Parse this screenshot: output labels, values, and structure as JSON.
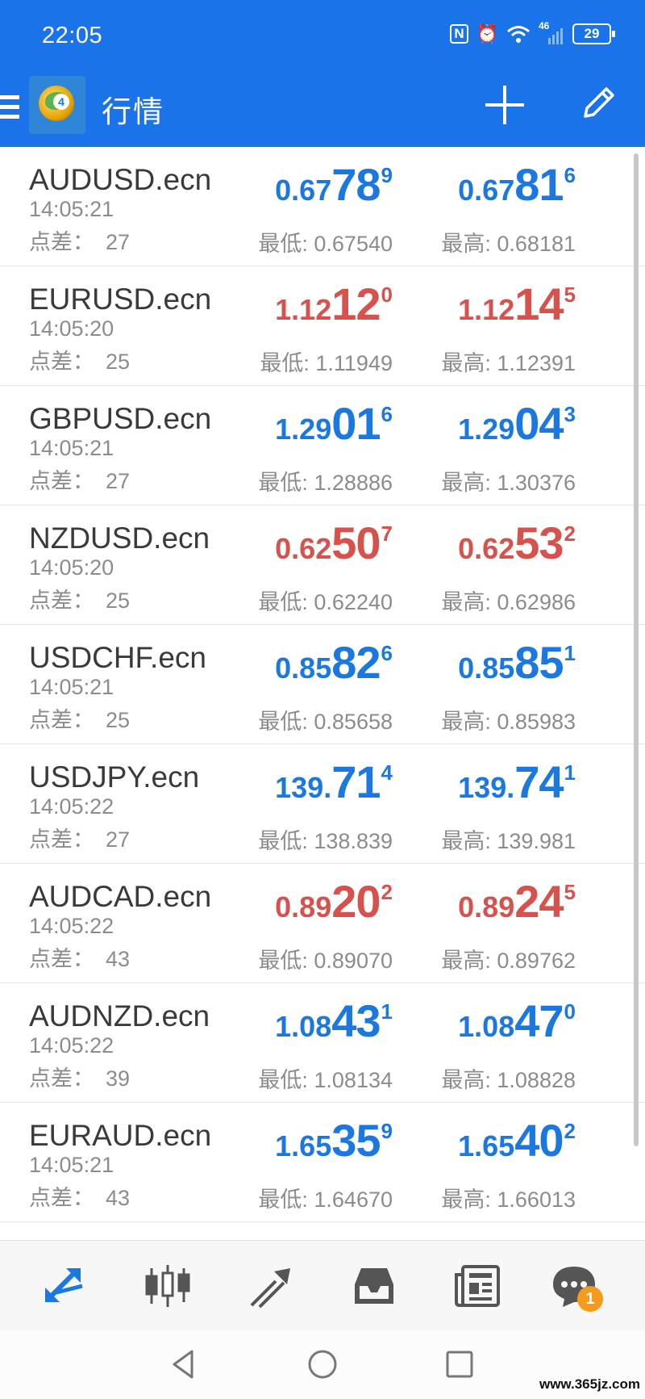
{
  "status_bar": {
    "time": "22:05",
    "nfc_icon": "N",
    "alarm_icon": "⏰",
    "wifi_icon": "wifi",
    "signal_label": "46",
    "battery": "29"
  },
  "app_bar": {
    "title": "行情",
    "menu_icon": "hamburger-icon",
    "logo_icon": "metatrader-logo",
    "add_icon": "plus-icon",
    "edit_icon": "pencil-icon"
  },
  "labels": {
    "spread": "点差：",
    "low": "最低: ",
    "high": "最高: "
  },
  "quotes": [
    {
      "symbol": "AUDUSD.ecn",
      "time": "14:05:21",
      "spread": "27",
      "bid": {
        "small": "0.67",
        "big": "78",
        "sup": "9"
      },
      "ask": {
        "small": "0.67",
        "big": "81",
        "sup": "6"
      },
      "low": "0.67540",
      "high": "0.68181",
      "color": "blue"
    },
    {
      "symbol": "EURUSD.ecn",
      "time": "14:05:20",
      "spread": "25",
      "bid": {
        "small": "1.12",
        "big": "12",
        "sup": "0"
      },
      "ask": {
        "small": "1.12",
        "big": "14",
        "sup": "5"
      },
      "low": "1.11949",
      "high": "1.12391",
      "color": "red"
    },
    {
      "symbol": "GBPUSD.ecn",
      "time": "14:05:21",
      "spread": "27",
      "bid": {
        "small": "1.29",
        "big": "01",
        "sup": "6"
      },
      "ask": {
        "small": "1.29",
        "big": "04",
        "sup": "3"
      },
      "low": "1.28886",
      "high": "1.30376",
      "color": "blue"
    },
    {
      "symbol": "NZDUSD.ecn",
      "time": "14:05:20",
      "spread": "25",
      "bid": {
        "small": "0.62",
        "big": "50",
        "sup": "7"
      },
      "ask": {
        "small": "0.62",
        "big": "53",
        "sup": "2"
      },
      "low": "0.62240",
      "high": "0.62986",
      "color": "red"
    },
    {
      "symbol": "USDCHF.ecn",
      "time": "14:05:21",
      "spread": "25",
      "bid": {
        "small": "0.85",
        "big": "82",
        "sup": "6"
      },
      "ask": {
        "small": "0.85",
        "big": "85",
        "sup": "1"
      },
      "low": "0.85658",
      "high": "0.85983",
      "color": "blue"
    },
    {
      "symbol": "USDJPY.ecn",
      "time": "14:05:22",
      "spread": "27",
      "bid": {
        "small": "139.",
        "big": "71",
        "sup": "4"
      },
      "ask": {
        "small": "139.",
        "big": "74",
        "sup": "1"
      },
      "low": "138.839",
      "high": "139.981",
      "color": "blue"
    },
    {
      "symbol": "AUDCAD.ecn",
      "time": "14:05:22",
      "spread": "43",
      "bid": {
        "small": "0.89",
        "big": "20",
        "sup": "2"
      },
      "ask": {
        "small": "0.89",
        "big": "24",
        "sup": "5"
      },
      "low": "0.89070",
      "high": "0.89762",
      "color": "red"
    },
    {
      "symbol": "AUDNZD.ecn",
      "time": "14:05:22",
      "spread": "39",
      "bid": {
        "small": "1.08",
        "big": "43",
        "sup": "1"
      },
      "ask": {
        "small": "1.08",
        "big": "47",
        "sup": "0"
      },
      "low": "1.08134",
      "high": "1.08828",
      "color": "blue"
    },
    {
      "symbol": "EURAUD.ecn",
      "time": "14:05:21",
      "spread": "43",
      "bid": {
        "small": "1.65",
        "big": "35",
        "sup": "9"
      },
      "ask": {
        "small": "1.65",
        "big": "40",
        "sup": "2"
      },
      "low": "1.64670",
      "high": "1.66013",
      "color": "blue"
    }
  ],
  "colors": {
    "blue": "#1b78e0",
    "red": "#d8524d",
    "appbar": "#1a73e8",
    "badge": "#f59a1b"
  },
  "bottom_nav": {
    "items": [
      "quotes-icon",
      "chart-icon",
      "trade-icon",
      "history-icon",
      "news-icon",
      "messages-icon"
    ],
    "messages_badge": "1"
  },
  "system_nav": {
    "items": [
      "back-icon",
      "home-icon",
      "recents-icon"
    ]
  },
  "watermark": "www.365jz.com"
}
